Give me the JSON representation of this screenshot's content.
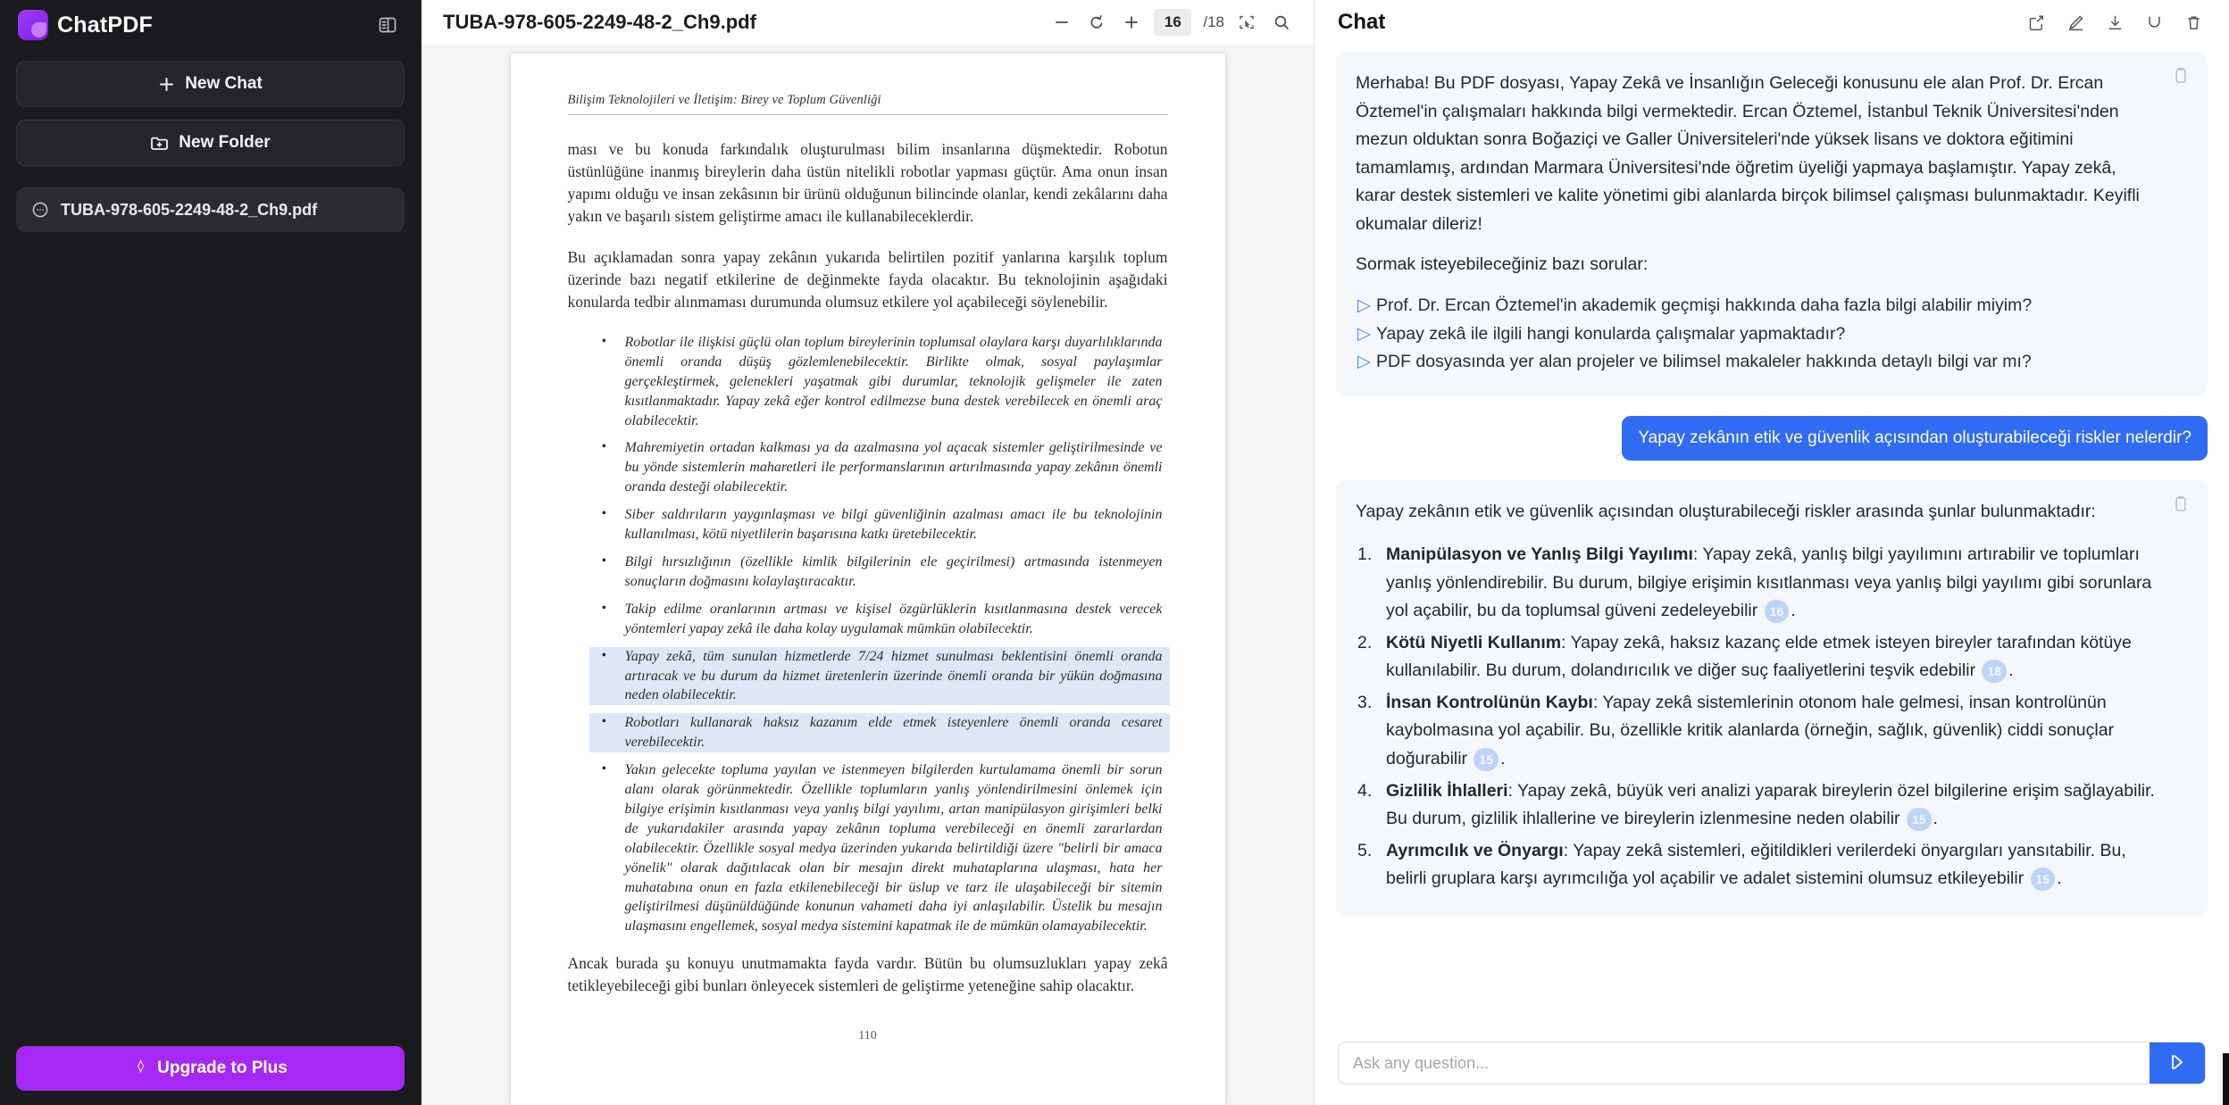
{
  "sidebar": {
    "brand_name": "ChatPDF",
    "brand_icon": "chatpdf-logo-icon",
    "panel_toggle_icon": "sidebar-panel-toggle-icon",
    "new_chat_label": "New Chat",
    "new_chat_icon": "plus-icon",
    "new_folder_label": "New Folder",
    "new_folder_icon": "folder-plus-icon",
    "files": [
      {
        "name": "TUBA-978-605-2249-48-2_Ch9.pdf",
        "icon": "pdf-file-icon",
        "selected": true
      }
    ],
    "upgrade_label": "Upgrade to Plus",
    "upgrade_icon": "diamond-icon",
    "upgrade_color": "#a528f5"
  },
  "pdf": {
    "title": "TUBA-978-605-2249-48-2_Ch9.pdf",
    "zoom_out_icon": "minus-icon",
    "rotate_icon": "rotate-ccw-icon",
    "zoom_in_icon": "plus-icon",
    "current_page": "16",
    "total_pages": "/18",
    "select_area_icon": "select-area-icon",
    "search_icon": "search-icon",
    "page": {
      "running_head": "Bilişim Teknolojileri ve İletişim: Birey ve Toplum Güvenliği",
      "paragraph_1": "ması ve bu konuda farkındalık oluşturulması bilim insanlarına düşmektedir. Robotun üstünlüğüne inanmış bireylerin daha üstün nitelikli robotlar yapması güçtür. Ama onun insan yapımı olduğu ve insan zekâsının bir ürünü olduğunun bilincinde olanlar, kendi zekâlarını daha yakın ve başarılı sistem geliştirme amacı ile kullanabileceklerdir.",
      "paragraph_2": "Bu açıklamadan sonra yapay zekânın yukarıda belirtilen pozitif yanlarına karşılık toplum üzerinde bazı negatif etkilerine de değinmekte fayda olacaktır. Bu teknolojinin aşağıdaki konularda tedbir alınmaması durumunda olumsuz etkilere yol açabileceği söylenebilir.",
      "bullets": [
        {
          "text": "Robotlar ile ilişkisi güçlü olan toplum bireylerinin toplumsal olaylara karşı duyarlılıklarında önemli oranda düşüş gözlemlenebilecektir. Birlikte olmak, sosyal paylaşımlar gerçekleştirmek, gelenekleri yaşatmak gibi durumlar, teknolojik gelişmeler ile zaten kısıtlanmaktadır. Yapay zekâ eğer kontrol edilmezse buna destek verebilecek en önemli araç olabilecektir.",
          "highlighted": false
        },
        {
          "text": "Mahremiyetin ortadan kalkması ya da azalmasına yol açacak sistemler geliştirilmesinde ve bu yönde sistemlerin maharetleri ile performanslarının artırılmasında yapay zekânın önemli oranda desteği olabilecektir.",
          "highlighted": false
        },
        {
          "text": "Siber saldırıların yaygınlaşması ve bilgi güvenliğinin azalması amacı ile bu teknolojinin kullanılması, kötü niyetlilerin başarısına katkı üretebilecektir.",
          "highlighted": false
        },
        {
          "text": "Bilgi hırsızlığının (özellikle kimlik bilgilerinin ele geçirilmesi) artmasında istenmeyen sonuçların doğmasını kolaylaştıracaktır.",
          "highlighted": false
        },
        {
          "text": "Takip edilme oranlarının artması ve kişisel özgürlüklerin kısıtlanmasına destek verecek yöntemleri yapay zekâ ile daha kolay uygulamak mümkün olabilecektir.",
          "highlighted": false
        },
        {
          "text": "Yapay zekâ, tüm sunulan hizmetlerde 7/24 hizmet sunulması beklentisini önemli oranda artıracak ve bu durum da hizmet üretenlerin üzerinde önemli oranda bir yükün doğmasına neden olabilecektir.",
          "highlighted": true
        },
        {
          "text": "Robotları kullanarak haksız kazanım elde etmek isteyenlere önemli oranda cesaret verebilecektir.",
          "highlighted": true
        },
        {
          "text": "Yakın gelecekte topluma yayılan ve istenmeyen bilgilerden kurtulamama önemli bir sorun alanı olarak görünmektedir. Özellikle toplumların yanlış yönlendirilmesini önlemek için bilgiye erişimin kısıtlanması veya yanlış bilgi yayılımı, artan manipülasyon girişimleri belki de yukarıdakiler arasında yapay zekânın topluma verebileceği en önemli zararlardan olabilecektir. Özellikle sosyal medya üzerinden yukarıda belirtildiği üzere \"belirli bir amaca yönelik\" olarak dağıtılacak olan bir mesajın direkt muhataplarına ulaşması, hata her muhatabına onun en fazla etkilenebileceği bir üslup ve tarz ile ulaşabileceği bir sitemin geliştirilmesi düşünüldüğünde konunun vahameti daha iyi anlaşılabilir. Üstelik bu mesajın ulaşmasını engellemek, sosyal medya sistemini kapatmak ile de mümkün olamayabilecektir.",
          "highlighted": false
        }
      ],
      "paragraph_3": "Ancak burada şu konuyu unutmamakta fayda vardır. Bütün bu olumsuzlukları yapay zekâ tetikleyebileceği gibi bunları önleyecek sistemleri de geliştirme yeteneğine sahip olacaktır.",
      "folio": "110"
    }
  },
  "chat": {
    "title": "Chat",
    "header_icons": [
      "share-icon",
      "edit-pencil-icon",
      "download-icon",
      "refresh-icon",
      "trash-icon"
    ],
    "copy_icon": "copy-icon",
    "intro": {
      "greeting": "Merhaba! Bu PDF dosyası, Yapay Zekâ ve İnsanlığın Geleceği konusunu ele alan Prof. Dr. Ercan Öztemel'in çalışmaları hakkında bilgi vermektedir. Ercan Öztemel, İstanbul Teknik Üniversitesi'nden mezun olduktan sonra Boğaziçi ve Galler Üniversiteleri'nde yüksek lisans ve doktora eğitimini tamamlamış, ardından Marmara Üniversitesi'nde öğretim üyeliği yapmaya başlamıştır. Yapay zekâ, karar destek sistemleri ve kalite yönetimi gibi alanlarda birçok bilimsel çalışması bulunmaktadır. Keyifli okumalar dileriz!",
      "suggest_heading": "Sormak isteyebileceğiniz bazı sorular:",
      "suggest_icon": "play-triangle-icon",
      "suggestions": [
        "Prof. Dr. Ercan Öztemel'in akademik geçmişi hakkında daha fazla bilgi alabilir miyim?",
        "Yapay zekâ ile ilgili hangi konularda çalışmalar yapmaktadır?",
        "PDF dosyasında yer alan projeler ve bilimsel makaleler hakkında detaylı bilgi var mı?"
      ]
    },
    "user_message": "Yapay zekânın etik ve güvenlik açısından oluşturabileceği riskler nelerdir?",
    "user_bubble_color": "#2f6bf3",
    "answer": {
      "lead": "Yapay zekânın etik ve güvenlik açısından oluşturabileceği riskler arasında şunlar bulunmaktadır:",
      "items": [
        {
          "title": "Manipülasyon ve Yanlış Bilgi Yayılımı",
          "body": ": Yapay zekâ, yanlış bilgi yayılımını artırabilir ve toplumları yanlış yönlendirebilir. Bu durum, bilgiye erişimin kısıtlanması veya yanlış bilgi yayılımı gibi sorunlara yol açabilir, bu da toplumsal güveni zedeleyebilir ",
          "cite": "16",
          "tail": "."
        },
        {
          "title": "Kötü Niyetli Kullanım",
          "body": ": Yapay zekâ, haksız kazanç elde etmek isteyen bireyler tarafından kötüye kullanılabilir. Bu durum, dolandırıcılık ve diğer suç faaliyetlerini teşvik edebilir ",
          "cite": "18",
          "tail": "."
        },
        {
          "title": "İnsan Kontrolünün Kaybı",
          "body": ": Yapay zekâ sistemlerinin otonom hale gelmesi, insan kontrolünün kaybolmasına yol açabilir. Bu, özellikle kritik alanlarda (örneğin, sağlık, güvenlik) ciddi sonuçlar doğurabilir ",
          "cite": "15",
          "tail": "."
        },
        {
          "title": "Gizlilik İhlalleri",
          "body": ": Yapay zekâ, büyük veri analizi yaparak bireylerin özel bilgilerine erişim sağlayabilir. Bu durum, gizlilik ihlallerine ve bireylerin izlenmesine neden olabilir ",
          "cite": "15",
          "tail": "."
        },
        {
          "title": "Ayrımcılık ve Önyargı",
          "body": ": Yapay zekâ sistemleri, eğitildikleri verilerdeki önyargıları yansıtabilir. Bu, belirli gruplara karşı ayrımcılığa yol açabilir ve adalet sistemini olumsuz etkileyebilir ",
          "cite": "15",
          "tail": "."
        }
      ]
    },
    "composer": {
      "placeholder": "Ask any question...",
      "value": "",
      "send_icon": "send-icon",
      "send_color": "#2f6bf3"
    }
  }
}
